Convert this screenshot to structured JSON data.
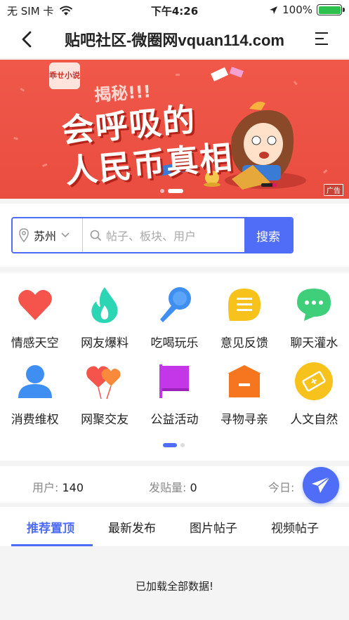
{
  "status_bar": {
    "carrier": "无 SIM 卡",
    "time": "下午4:26",
    "battery": "100%",
    "battery_level": 1.0
  },
  "nav": {
    "title": "贴吧社区-微圈网vquan114.com",
    "back_icon": "chevron-left-icon",
    "menu_icon": "menu-icon"
  },
  "banner": {
    "badge": "乖ㄝ小说",
    "reveal": "揭秘!!!",
    "headline_line1": "会呼吸的",
    "headline_line2": "人民币真相",
    "ad_tag": "广告",
    "slide_count": 2,
    "active_slide": 2
  },
  "search": {
    "city": "苏州",
    "placeholder": "帖子、板块、用户",
    "button": "搜索",
    "accent": "#4f6df6"
  },
  "categories": [
    {
      "label": "情感天空",
      "icon": "heart-icon",
      "color": "#f4544c"
    },
    {
      "label": "网友爆料",
      "icon": "flame-icon",
      "color": "#2cd6b4"
    },
    {
      "label": "吃喝玩乐",
      "icon": "microphone-icon",
      "color": "#3f8ff2"
    },
    {
      "label": "意见反馈",
      "icon": "feedback-icon",
      "color": "#f7c21c"
    },
    {
      "label": "聊天灌水",
      "icon": "chat-icon",
      "color": "#3fcf7a"
    },
    {
      "label": "消费维权",
      "icon": "user-icon",
      "color": "#3f8ff2"
    },
    {
      "label": "网聚交友",
      "icon": "balloons-icon",
      "color": "#f4544c"
    },
    {
      "label": "公益活动",
      "icon": "flag-icon",
      "color": "#c337e8"
    },
    {
      "label": "寻物寻亲",
      "icon": "box-icon",
      "color": "#f6761f"
    },
    {
      "label": "人文自然",
      "icon": "ticket-icon",
      "color": "#f7c21c"
    }
  ],
  "stats": {
    "users_label": "用户: ",
    "users_value": "140",
    "posts_label": "发贴量: ",
    "posts_value": "0",
    "today_label": "今日: "
  },
  "tabs": [
    "推荐置顶",
    "最新发布",
    "图片帖子",
    "视频帖子"
  ],
  "active_tab": 0,
  "footer_message": "已加载全部数据!"
}
